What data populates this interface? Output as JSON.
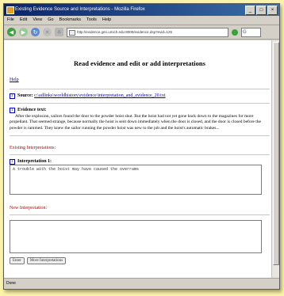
{
  "window": {
    "title": "Existing Evidence Source and Interpretations - Mozilla Firefox"
  },
  "menu": [
    "File",
    "Edit",
    "View",
    "Go",
    "Bookmarks",
    "Tools",
    "Help"
  ],
  "address": {
    "url": "http://evidence.gen.umich.edu:8000/evidence.dsp?evid=125"
  },
  "search": {
    "label": "G"
  },
  "page": {
    "heading": "Read evidence and edit or add interpretations",
    "help_link": "Help",
    "source_label": "Source:",
    "source_link": "c:\\adlinks\\worldhistory\\evidence\\interpretation_and_evidence_20.txt",
    "evidence_label": "Evidence text:",
    "evidence_text": "After the explosion, sailors found the door to the powder hoist shut. But the hoist had not yet gone back down to the magazines for more propellant. That seemed strange, because normally the hoist is sent down immediately when the door is closed, and the door is closed before the powder is rammed. They knew the sailor running the powder hoist was new to the job and the hoist's automatic brakes...",
    "existing_heading": "Existing Interpretations:",
    "interp_label": "Interpretation 1:",
    "interp_text": "A trouble with the hoist may have caused the overrams",
    "new_heading": "New Interpretation:",
    "new_value": "",
    "btn_enter": "Enter",
    "btn_more": "More Interpretations",
    "marker": "1"
  },
  "status": {
    "text": "Done"
  }
}
